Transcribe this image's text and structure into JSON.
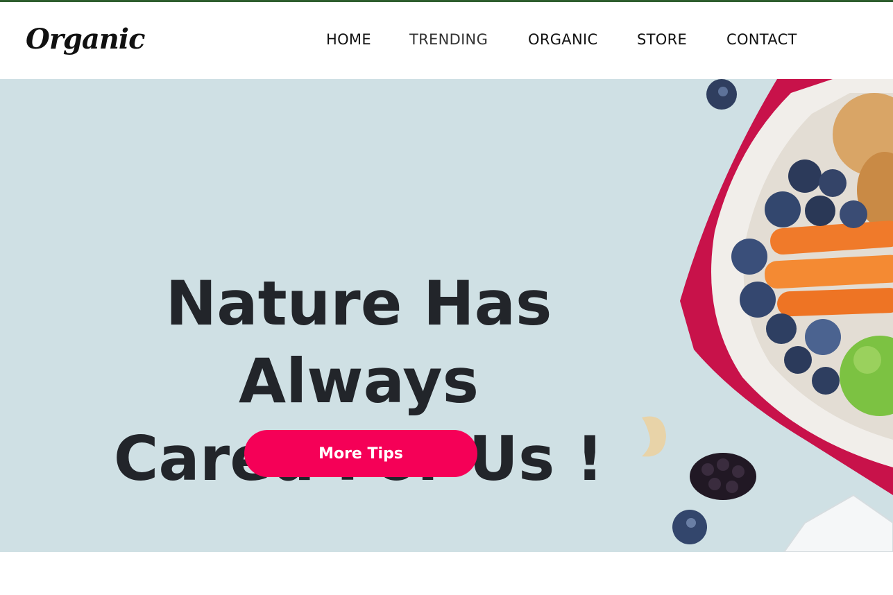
{
  "brand": {
    "logo": "Organic"
  },
  "nav": {
    "items": [
      {
        "label": "HOME"
      },
      {
        "label": "TRENDING"
      },
      {
        "label": "ORGANIC"
      },
      {
        "label": "STORE"
      },
      {
        "label": "CONTACT"
      }
    ]
  },
  "hero": {
    "title_line1": "Nature Has Always",
    "title_line2": "Cared For Us !",
    "cta_label": "More Tips",
    "image_subject": "lunchbox with blueberries, carrots, green apple, bread, cashew and blackberry"
  },
  "colors": {
    "top_border": "#2e5e2e",
    "hero_background": "#cfe0e4",
    "cta": "#f50057",
    "title": "#22252a"
  }
}
